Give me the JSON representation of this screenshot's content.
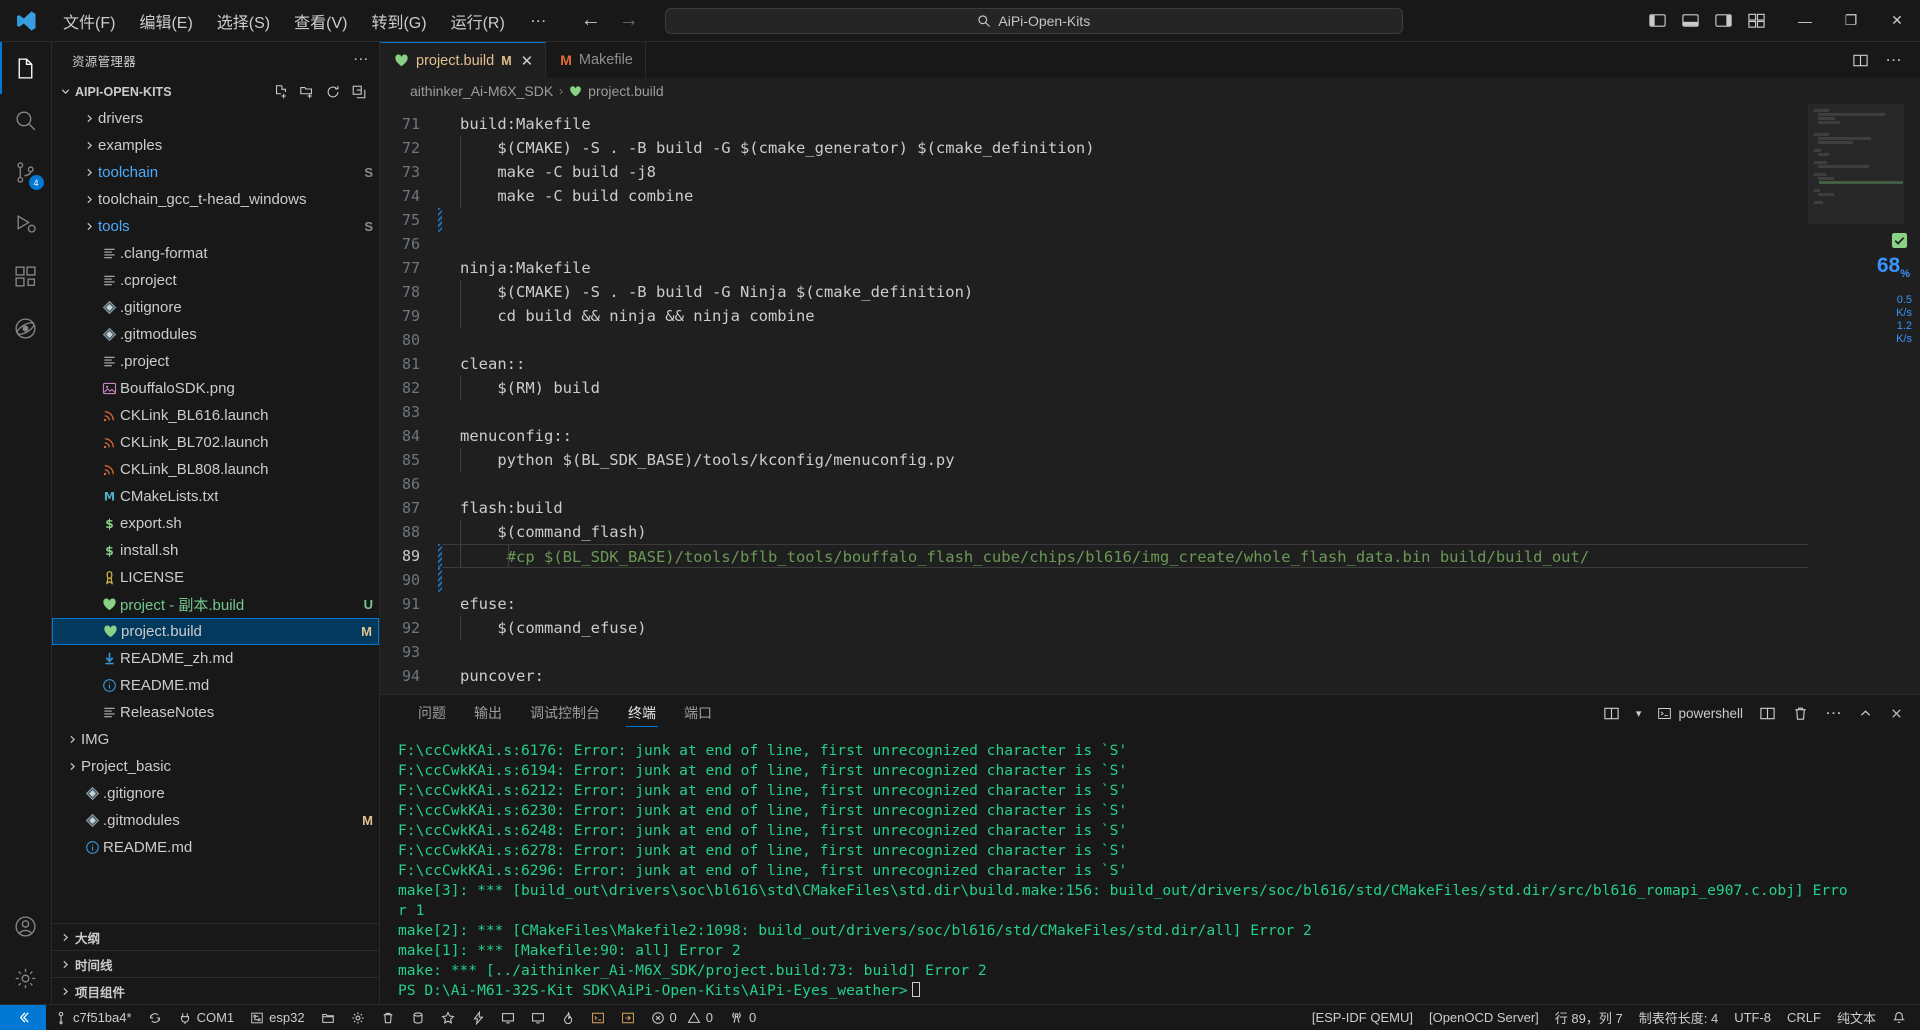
{
  "titlebar": {
    "menus": [
      "文件(F)",
      "编辑(E)",
      "选择(S)",
      "查看(V)",
      "转到(G)",
      "运行(R)"
    ],
    "more": "…",
    "search_text": "AiPi-Open-Kits",
    "nav_back": "←",
    "nav_forward": "→",
    "minimize": "—",
    "maximize": "❐",
    "close": "✕"
  },
  "activitybar": {
    "items": [
      {
        "name": "explorer",
        "icon": "files-icon",
        "badge": ""
      },
      {
        "name": "search",
        "icon": "search-icon",
        "badge": ""
      },
      {
        "name": "source-control",
        "icon": "source-control-icon",
        "badge": "4"
      },
      {
        "name": "run-and-debug",
        "icon": "debug-icon",
        "badge": ""
      },
      {
        "name": "extensions",
        "icon": "extensions-icon",
        "badge": ""
      },
      {
        "name": "platformio",
        "icon": "platformio-icon",
        "badge": ""
      }
    ],
    "bottom": [
      {
        "name": "accounts",
        "icon": "account-icon"
      },
      {
        "name": "settings",
        "icon": "gear-icon"
      }
    ]
  },
  "sidebar": {
    "title": "资源管理器",
    "more_label": "…",
    "root": {
      "label": "AIPI-OPEN-KITS",
      "actions": [
        "new-file-icon",
        "new-folder-icon",
        "refresh-icon",
        "collapse-all-icon"
      ]
    },
    "tree": [
      {
        "label": "drivers",
        "type": "folder",
        "color": "c-white",
        "mark": ""
      },
      {
        "label": "examples",
        "type": "folder",
        "color": "c-white",
        "mark": ""
      },
      {
        "label": "toolchain",
        "type": "folder",
        "color": "c-blue",
        "mark": "S"
      },
      {
        "label": "toolchain_gcc_t-head_windows",
        "type": "folder",
        "color": "c-white",
        "mark": ""
      },
      {
        "label": "tools",
        "type": "folder",
        "color": "c-blue",
        "mark": "S"
      },
      {
        "label": ".clang-format",
        "type": "file",
        "icon": "settings-file-icon",
        "color": "c-white",
        "mark": ""
      },
      {
        "label": ".cproject",
        "type": "file",
        "icon": "settings-file-icon",
        "color": "c-white",
        "mark": ""
      },
      {
        "label": ".gitignore",
        "type": "file",
        "icon": "git-icon",
        "color": "c-white",
        "mark": ""
      },
      {
        "label": ".gitmodules",
        "type": "file",
        "icon": "git-icon",
        "color": "c-white",
        "mark": ""
      },
      {
        "label": ".project",
        "type": "file",
        "icon": "settings-file-icon",
        "color": "c-white",
        "mark": ""
      },
      {
        "label": "BouffaloSDK.png",
        "type": "file",
        "icon": "image-icon",
        "color": "c-white",
        "mark": ""
      },
      {
        "label": "CKLink_BL616.launch",
        "type": "file",
        "icon": "launch-icon",
        "color": "c-white",
        "mark": ""
      },
      {
        "label": "CKLink_BL702.launch",
        "type": "file",
        "icon": "launch-icon",
        "color": "c-white",
        "mark": ""
      },
      {
        "label": "CKLink_BL808.launch",
        "type": "file",
        "icon": "launch-icon",
        "color": "c-white",
        "mark": ""
      },
      {
        "label": "CMakeLists.txt",
        "type": "file",
        "icon": "cmake-icon",
        "color": "c-white",
        "mark": ""
      },
      {
        "label": "export.sh",
        "type": "file",
        "icon": "shell-icon",
        "color": "c-white",
        "mark": ""
      },
      {
        "label": "install.sh",
        "type": "file",
        "icon": "shell-icon",
        "color": "c-white",
        "mark": ""
      },
      {
        "label": "LICENSE",
        "type": "file",
        "icon": "license-icon",
        "color": "c-white",
        "mark": ""
      },
      {
        "label": "project - 副本.build",
        "type": "file",
        "icon": "build-icon",
        "color": "c-green",
        "mark": "U"
      },
      {
        "label": "project.build",
        "type": "file",
        "icon": "build-icon",
        "color": "c-white",
        "mark": "M",
        "selected": true
      },
      {
        "label": "README_zh.md",
        "type": "file",
        "icon": "markdown-icon",
        "color": "c-white",
        "mark": ""
      },
      {
        "label": "README.md",
        "type": "file",
        "icon": "info-icon",
        "color": "c-white",
        "mark": ""
      },
      {
        "label": "ReleaseNotes",
        "type": "file",
        "icon": "settings-file-icon",
        "color": "c-white",
        "mark": ""
      }
    ],
    "tree_level1": [
      {
        "label": "IMG",
        "type": "folder",
        "color": "c-white",
        "mark": ""
      },
      {
        "label": "Project_basic",
        "type": "folder",
        "color": "c-white",
        "mark": ""
      },
      {
        "label": ".gitignore",
        "type": "file",
        "icon": "git-icon",
        "color": "c-white",
        "mark": ""
      },
      {
        "label": ".gitmodules",
        "type": "file",
        "icon": "git-icon",
        "color": "c-white",
        "mark": "M"
      },
      {
        "label": "README.md",
        "type": "file",
        "icon": "info-icon",
        "color": "c-white",
        "mark": ""
      }
    ],
    "collapsed_panels": [
      "大纲",
      "时间线",
      "项目组件"
    ]
  },
  "editor": {
    "tabs": [
      {
        "label": "project.build",
        "icon": "build-icon",
        "mark": "M",
        "active": true,
        "closable": true
      },
      {
        "label": "Makefile",
        "icon": "makefile-icon",
        "mark": "",
        "active": false,
        "closable": false
      }
    ],
    "tab_actions": [
      "split-editor-icon",
      "more-actions-icon"
    ],
    "breadcrumb": [
      "aithinker_Ai-M6X_SDK",
      "project.build"
    ],
    "breadcrumb_sep": "›",
    "first_line_number": 71,
    "lines": [
      {
        "n": 71,
        "text": "build:Makefile",
        "indent": 0,
        "diff": false
      },
      {
        "n": 72,
        "text": "    $(CMAKE) -S . -B build -G $(cmake_generator) $(cmake_definition)",
        "indent": 1,
        "diff": false
      },
      {
        "n": 73,
        "text": "    make -C build -j8",
        "indent": 1,
        "diff": false
      },
      {
        "n": 74,
        "text": "    make -C build combine",
        "indent": 1,
        "diff": false
      },
      {
        "n": 75,
        "text": "",
        "indent": 0,
        "diff": true
      },
      {
        "n": 76,
        "text": "",
        "indent": 0,
        "diff": false
      },
      {
        "n": 77,
        "text": "ninja:Makefile",
        "indent": 0,
        "diff": false
      },
      {
        "n": 78,
        "text": "    $(CMAKE) -S . -B build -G Ninja $(cmake_definition)",
        "indent": 1,
        "diff": false
      },
      {
        "n": 79,
        "text": "    cd build && ninja && ninja combine",
        "indent": 1,
        "diff": false
      },
      {
        "n": 80,
        "text": "",
        "indent": 0,
        "diff": false
      },
      {
        "n": 81,
        "text": "clean::",
        "indent": 0,
        "diff": false
      },
      {
        "n": 82,
        "text": "    $(RM) build",
        "indent": 1,
        "diff": false
      },
      {
        "n": 83,
        "text": "",
        "indent": 0,
        "diff": false
      },
      {
        "n": 84,
        "text": "menuconfig::",
        "indent": 0,
        "diff": false
      },
      {
        "n": 85,
        "text": "    python $(BL_SDK_BASE)/tools/kconfig/menuconfig.py",
        "indent": 1,
        "diff": false
      },
      {
        "n": 86,
        "text": "",
        "indent": 0,
        "diff": false
      },
      {
        "n": 87,
        "text": "flash:build",
        "indent": 0,
        "diff": false
      },
      {
        "n": 88,
        "text": "    $(command_flash)",
        "indent": 1,
        "diff": false
      },
      {
        "n": 89,
        "text": "     #cp $(BL_SDK_BASE)/tools/bflb_tools/bouffalo_flash_cube/chips/bl616/img_create/whole_flash_data.bin build/build_out/",
        "indent": 2,
        "diff": true,
        "comment": true,
        "current": true
      },
      {
        "n": 90,
        "text": "",
        "indent": 0,
        "diff": true
      },
      {
        "n": 91,
        "text": "efuse:",
        "indent": 0,
        "diff": false
      },
      {
        "n": 92,
        "text": "    $(command_efuse)",
        "indent": 1,
        "diff": false
      },
      {
        "n": 93,
        "text": "",
        "indent": 0,
        "diff": false
      },
      {
        "n": 94,
        "text": "puncover:",
        "indent": 0,
        "diff": false
      }
    ],
    "zoom_percent": "68",
    "zoom_percent_unit": "%",
    "net_up": "0.5",
    "net_up_unit": "K/s",
    "net_down": "1.2",
    "net_down_unit": "K/s"
  },
  "panel": {
    "tabs": [
      "问题",
      "输出",
      "调试控制台",
      "终端",
      "端口"
    ],
    "active_tab": "终端",
    "terminal_name": "powershell",
    "actions": [
      "split-terminal-icon",
      "trash-icon",
      "more-icon",
      "chevron-up-icon",
      "close-icon"
    ],
    "terminal_lines": [
      "F:\\ccCwkKAi.s:6176: Error: junk at end of line, first unrecognized character is `S'",
      "F:\\ccCwkKAi.s:6194: Error: junk at end of line, first unrecognized character is `S'",
      "F:\\ccCwkKAi.s:6212: Error: junk at end of line, first unrecognized character is `S'",
      "F:\\ccCwkKAi.s:6230: Error: junk at end of line, first unrecognized character is `S'",
      "F:\\ccCwkKAi.s:6248: Error: junk at end of line, first unrecognized character is `S'",
      "F:\\ccCwkKAi.s:6278: Error: junk at end of line, first unrecognized character is `S'",
      "F:\\ccCwkKAi.s:6296: Error: junk at end of line, first unrecognized character is `S'",
      "make[3]: *** [build_out\\drivers\\soc\\bl616\\std\\CMakeFiles\\std.dir\\build.make:156: build_out/drivers/soc/bl616/std/CMakeFiles/std.dir/src/bl616_romapi_e907.c.obj] Erro",
      "r 1",
      "make[2]: *** [CMakeFiles\\Makefile2:1098: build_out/drivers/soc/bl616/std/CMakeFiles/std.dir/all] Error 2",
      "make[1]: *** [Makefile:90: all] Error 2",
      "make: *** [../aithinker_Ai-M6X_SDK/project.build:73: build] Error 2",
      "PS D:\\Ai-M61-32S-Kit SDK\\AiPi-Open-Kits\\AiPi-Eyes_weather>"
    ]
  },
  "statusbar": {
    "remote_icon": "remote-window-icon",
    "left_items": [
      {
        "name": "git-branch",
        "icon": "git-branch-icon",
        "label": "c7f51ba4*"
      },
      {
        "name": "sync-changes",
        "icon": "sync-icon",
        "label": ""
      },
      {
        "name": "serial-port",
        "icon": "plug-icon",
        "label": "COM1"
      },
      {
        "name": "board",
        "icon": "board-icon",
        "label": "esp32"
      },
      {
        "name": "build-folder",
        "icon": "folder-icon",
        "label": ""
      },
      {
        "name": "settings",
        "icon": "gear-icon",
        "label": ""
      },
      {
        "name": "clean",
        "icon": "trash-icon",
        "label": ""
      },
      {
        "name": "flash",
        "icon": "database-icon",
        "label": ""
      },
      {
        "name": "favorite",
        "icon": "star-icon",
        "label": ""
      },
      {
        "name": "flash-device",
        "icon": "lightning-icon",
        "label": ""
      },
      {
        "name": "monitor",
        "icon": "monitor-icon",
        "label": ""
      },
      {
        "name": "monitor-2",
        "icon": "monitor-icon",
        "label": ""
      },
      {
        "name": "flame",
        "icon": "flame-icon",
        "label": ""
      },
      {
        "name": "terminal",
        "icon": "terminal-icon",
        "label": ""
      },
      {
        "name": "open-window",
        "icon": "open-window-icon",
        "label": ""
      }
    ],
    "errors": "0",
    "warnings": "0",
    "radio": "0",
    "right_items": [
      {
        "name": "esp-idf-qemu",
        "label": "[ESP-IDF QEMU]"
      },
      {
        "name": "openocd-server",
        "label": "[OpenOCD Server]"
      },
      {
        "name": "cursor-position",
        "label": "行 89，列 7"
      },
      {
        "name": "indentation",
        "label": "制表符长度: 4"
      },
      {
        "name": "encoding",
        "label": "UTF-8"
      },
      {
        "name": "eol",
        "label": "CRLF"
      },
      {
        "name": "language-mode",
        "label": "纯文本"
      }
    ],
    "bell_icon": "bell-icon"
  }
}
